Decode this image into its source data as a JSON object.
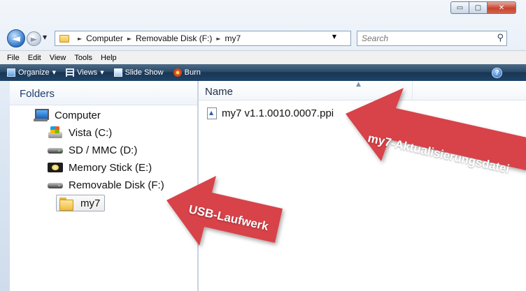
{
  "window": {
    "controls": {
      "minimize_glyph": "▭",
      "maximize_glyph": "▢",
      "close_glyph": "✕"
    }
  },
  "navigation": {
    "back_glyph": "◄",
    "forward_glyph": "►",
    "breadcrumbs": [
      "Computer",
      "Removable Disk (F:)",
      "my7"
    ],
    "search_placeholder": "Search"
  },
  "menu": [
    "File",
    "Edit",
    "View",
    "Tools",
    "Help"
  ],
  "toolbar": {
    "organize": "Organize",
    "views": "Views",
    "slideshow": "Slide Show",
    "burn": "Burn",
    "help_glyph": "?"
  },
  "folders_pane": {
    "header": "Folders",
    "items": [
      {
        "label": "Computer",
        "icon": "computer-icon"
      },
      {
        "label": "Vista (C:)",
        "icon": "windows-drive-icon"
      },
      {
        "label": "SD / MMC (D:)",
        "icon": "drive-icon"
      },
      {
        "label": "Memory Stick (E:)",
        "icon": "memory-stick-icon"
      },
      {
        "label": "Removable Disk (F:)",
        "icon": "drive-icon"
      },
      {
        "label": "my7",
        "icon": "folder-icon",
        "selected": true
      }
    ]
  },
  "files_pane": {
    "column_name": "Name",
    "files": [
      {
        "name": "my7 v1.1.0010.0007.ppi",
        "icon": "firmware-file-icon"
      }
    ]
  },
  "annotations": {
    "update_file": "my7-Aktualisierungsdatei",
    "usb_drive": "USB-Laufwerk",
    "arrow_color": "#d8434a"
  }
}
